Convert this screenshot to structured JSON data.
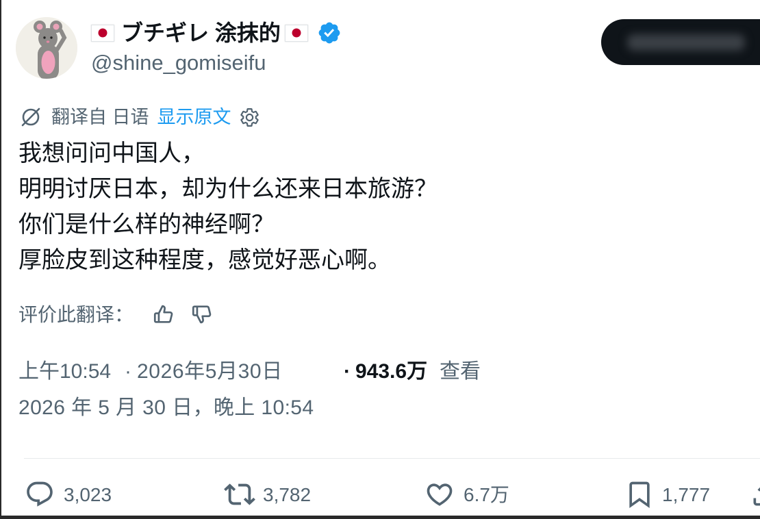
{
  "profile": {
    "display_name": "ブチギレ 涂抹的",
    "handle": "@shine_gomiseifu",
    "verified": true,
    "flag_icon": "japan-flag-icon",
    "avatar_icon": "gray-mouse-avatar"
  },
  "translation": {
    "translated_from": "翻译自 日语",
    "show_original": "显示原文",
    "icon": "translate-icon",
    "settings_icon": "gear-icon"
  },
  "tweet": {
    "lines": [
      "我想问问中国人，",
      "明明讨厌日本，却为什么还来日本旅游？",
      "你们是什么样的神经啊？",
      "厚脸皮到这种程度，感觉好恶心啊。"
    ]
  },
  "rate_translation": {
    "label": "评价此翻译：",
    "up_icon": "thumbs-up-icon",
    "down_icon": "thumbs-down-icon"
  },
  "meta": {
    "time": "上午10:54",
    "separator": "·",
    "date": "2026年5月30日",
    "views_count": "943.6万",
    "views_label": "查看",
    "full_datetime": "2026 年 5 月 30 日，晚上 10:54"
  },
  "actions": {
    "reply": {
      "count": "3,023",
      "icon": "reply-icon"
    },
    "retweet": {
      "count": "3,782",
      "icon": "retweet-icon"
    },
    "like": {
      "count": "6.7万",
      "icon": "heart-icon"
    },
    "bookmark": {
      "count": "1,777",
      "icon": "bookmark-icon"
    },
    "share": {
      "icon": "share-icon"
    }
  },
  "colors": {
    "text": "#0f1419",
    "secondary": "#536471",
    "accent": "#1d9bf0",
    "pill": "#0f1419",
    "flag_red": "#bc002d",
    "divider": "#e7eaec"
  }
}
